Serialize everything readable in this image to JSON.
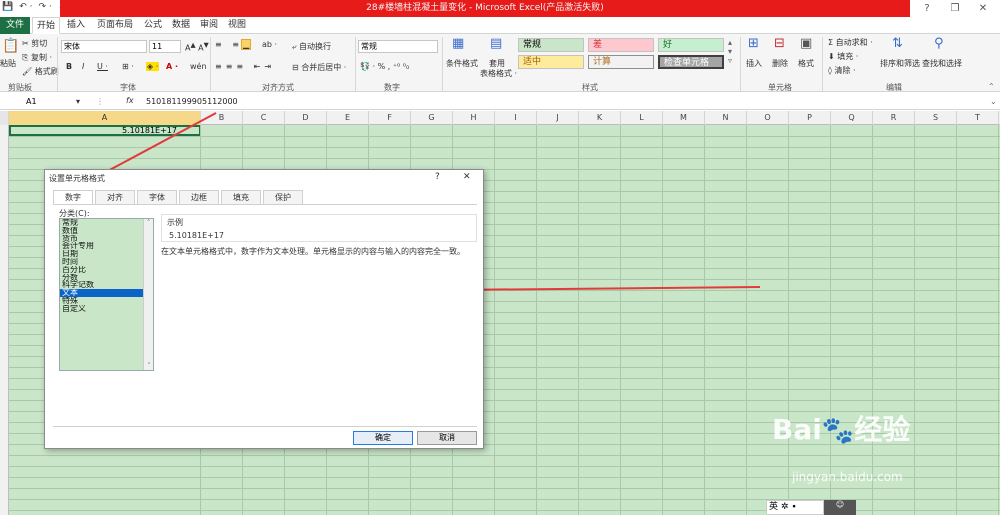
{
  "window": {
    "title": "28#楼墙柱混凝土量变化 - Microsoft Excel(产品激活失败)"
  },
  "tabs": [
    "文件",
    "开始",
    "插入",
    "页面布局",
    "公式",
    "数据",
    "审阅",
    "视图"
  ],
  "ribbon": {
    "clipboard": {
      "cut": "剪切",
      "copy": "复制 ·",
      "painter": "格式刷",
      "paste": "粘贴",
      "label": "剪贴板"
    },
    "font": {
      "name": "宋体",
      "size": "11",
      "label": "字体"
    },
    "align": {
      "wrap": "自动换行",
      "merge": "合并后居中 ·",
      "label": "对齐方式"
    },
    "number": {
      "format": "常规",
      "label": "数字"
    },
    "styles": {
      "cond": "条件格式",
      "table": "套用",
      "table2": "表格格式 ·",
      "label": "样式",
      "cells": [
        "常规",
        "差",
        "好",
        "适中",
        "计算",
        "检查单元格"
      ]
    },
    "cells": {
      "insert": "插入",
      "delete": "删除",
      "format": "格式",
      "label": "单元格"
    },
    "edit": {
      "autosum": "自动求和 ·",
      "fill": "填充 ·",
      "clear": "清除 ·",
      "sort": "排序和筛选",
      "find": "查找和选择",
      "label": "编辑"
    }
  },
  "formula_bar": {
    "cell_ref": "A1",
    "fx": "fx",
    "value": "510181199905112000"
  },
  "grid": {
    "columns": [
      "A",
      "B",
      "C",
      "D",
      "E",
      "F",
      "G",
      "H",
      "I",
      "J",
      "K",
      "L",
      "M",
      "N",
      "O",
      "P",
      "Q",
      "R",
      "S",
      "T"
    ],
    "a1_value": "5.10181E+17"
  },
  "dialog": {
    "title": "设置单元格格式",
    "help": "?",
    "close": "✕",
    "tabs": [
      "数字",
      "对齐",
      "字体",
      "边框",
      "填充",
      "保护"
    ],
    "category_label": "分类(C):",
    "categories": [
      "常规",
      "数值",
      "货币",
      "会计专用",
      "日期",
      "时间",
      "百分比",
      "分数",
      "科学记数",
      "文本",
      "特殊",
      "自定义"
    ],
    "selected": "文本",
    "sample_label": "示例",
    "sample_value": "5.10181E+17",
    "description": "在文本单元格格式中，数字作为文本处理。单元格显示的内容与输入的内容完全一致。",
    "ok": "确定",
    "cancel": "取消"
  },
  "watermark": {
    "brand": "Bai",
    "brand2": "经验",
    "url": "jingyan.baidu.com"
  },
  "ime": {
    "lang": "英"
  }
}
